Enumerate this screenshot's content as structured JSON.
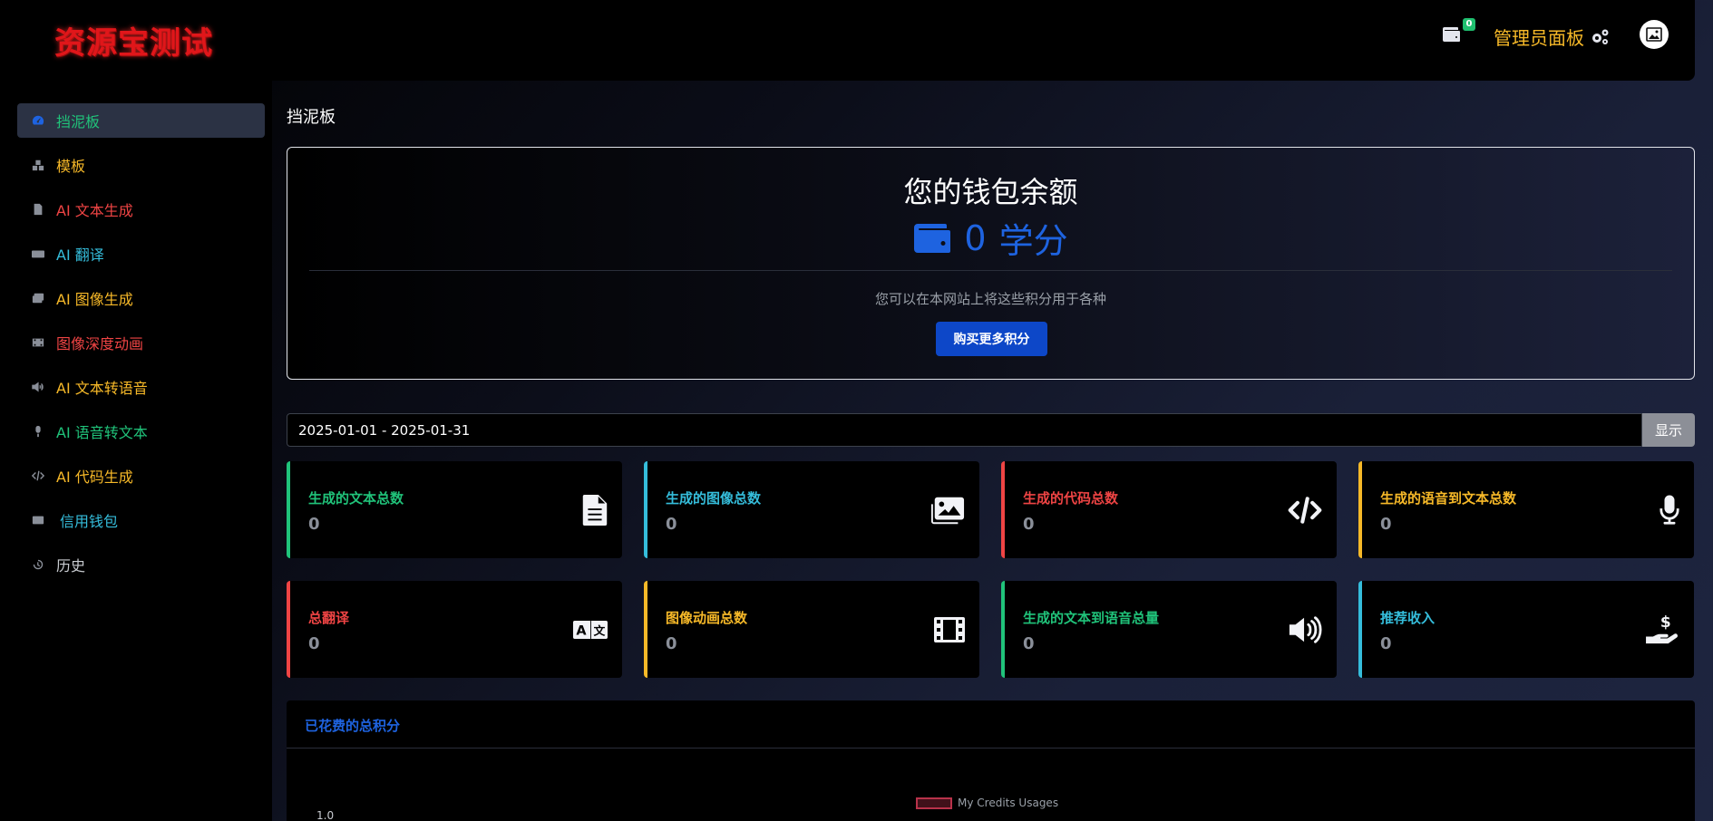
{
  "brand": {
    "logo_text": "资源宝测试"
  },
  "header": {
    "wallet_badge": "0",
    "admin_label": "管理员面板"
  },
  "sidebar": {
    "items": [
      {
        "label": "挡泥板",
        "icon": "dashboard-icon",
        "color": "#20c37a"
      },
      {
        "label": "模板",
        "icon": "boxes-icon",
        "color": "#f7b928"
      },
      {
        "label": "AI 文本生成",
        "icon": "file-text-icon",
        "color": "#ef4444"
      },
      {
        "label": "AI 翻译",
        "icon": "language-icon",
        "color": "#35bddb"
      },
      {
        "label": "AI 图像生成",
        "icon": "images-icon",
        "color": "#f7b928"
      },
      {
        "label": "图像深度动画",
        "icon": "film-icon",
        "color": "#ef4444"
      },
      {
        "label": "AI 文本转语音",
        "icon": "volume-icon",
        "color": "#f7b928"
      },
      {
        "label": "AI 语音转文本",
        "icon": "microphone-icon",
        "color": "#20c37a"
      },
      {
        "label": "AI 代码生成",
        "icon": "code-icon",
        "color": "#f7b928"
      },
      {
        "label": "信用钱包",
        "icon": "wallet-icon",
        "color": "#35bddb"
      },
      {
        "label": "历史",
        "icon": "history-icon",
        "color": "#c9ccd1"
      }
    ]
  },
  "main": {
    "page_title": "挡泥板",
    "wallet": {
      "title": "您的钱包余额",
      "amount": "0",
      "unit": "学分",
      "description": "您可以在本网站上将这些积分用于各种",
      "buy_label": "购买更多积分"
    },
    "date_filter": {
      "value": "2025-01-01 - 2025-01-31",
      "show_label": "显示"
    },
    "stats": [
      {
        "label": "生成的文本总数",
        "value": "0",
        "color": "#20c37a",
        "icon": "file-text-icon"
      },
      {
        "label": "生成的图像总数",
        "value": "0",
        "color": "#35bddb",
        "icon": "images-icon"
      },
      {
        "label": "生成的代码总数",
        "value": "0",
        "color": "#ef4444",
        "icon": "code-icon"
      },
      {
        "label": "生成的语音到文本总数",
        "value": "0",
        "color": "#f7b928",
        "icon": "microphone-icon"
      },
      {
        "label": "总翻译",
        "value": "0",
        "color": "#ef4444",
        "icon": "language-icon"
      },
      {
        "label": "图像动画总数",
        "value": "0",
        "color": "#f7b928",
        "icon": "film-icon"
      },
      {
        "label": "生成的文本到语音总量",
        "value": "0",
        "color": "#20c37a",
        "icon": "volume-icon"
      },
      {
        "label": "推荐收入",
        "value": "0",
        "color": "#35bddb",
        "icon": "hand-dollar-icon"
      }
    ],
    "chart": {
      "title": "已花费的总积分",
      "legend": "My Credits Usages",
      "ytick_top": "1.0"
    }
  }
}
